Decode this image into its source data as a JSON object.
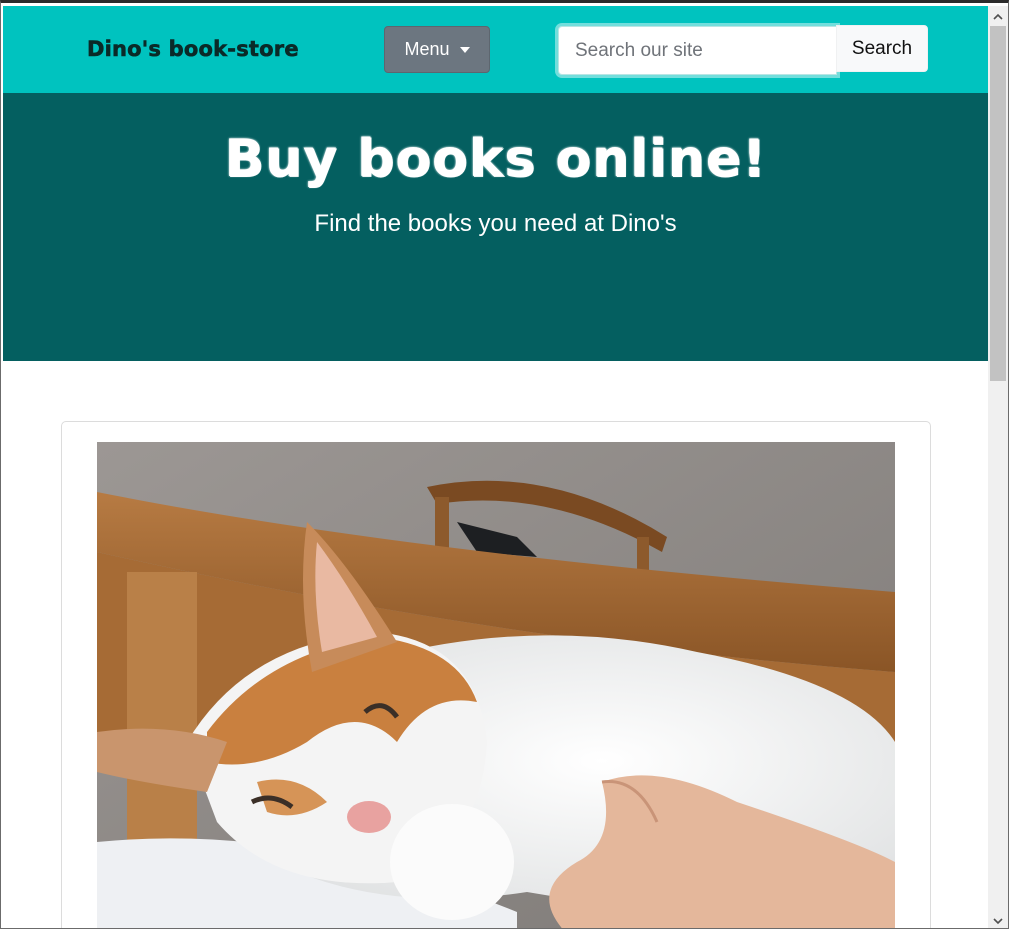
{
  "navbar": {
    "brand": "Dino's book-store",
    "menu_label": "Menu",
    "search_placeholder": "Search our site",
    "search_value": "",
    "search_button": "Search"
  },
  "hero": {
    "title": "Buy books online!",
    "subtitle": "Find the books you need at Dino's"
  },
  "content": {
    "image_subject": "ginger-and-white cat sleeping on bed with a hand beside its paw"
  },
  "colors": {
    "navbar_bg": "#00c3bf",
    "hero_bg": "#045f60",
    "menu_button_bg": "#6c7680"
  },
  "icons": {
    "menu_caret": "chevron-down-icon",
    "scroll_up": "chevron-up-icon",
    "scroll_down": "chevron-down-icon"
  }
}
